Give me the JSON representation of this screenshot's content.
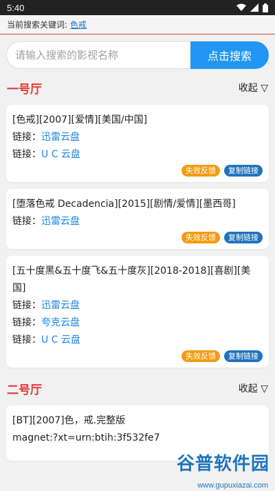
{
  "status_bar": {
    "time": "5:40"
  },
  "keyword_bar": {
    "label": "当前搜索关键词:",
    "keyword": "色戒"
  },
  "search": {
    "placeholder": "请输入搜索的影视名称",
    "button_label": "点击搜索"
  },
  "sections": [
    {
      "title": "一号厅",
      "collapse_label": "收起 ▽",
      "cards": [
        {
          "title": "[色戒][2007][爱情][美国/中国]",
          "links": [
            {
              "label": "链接：",
              "text": "迅雷云盘"
            },
            {
              "label": "链接：",
              "text": "U C 云盘"
            }
          ],
          "feedback_label": "失效反馈",
          "copy_label": "复制链接"
        },
        {
          "title": "[堕落色戒 Decadencia][2015][剧情/爱情][墨西哥]",
          "links": [
            {
              "label": "链接：",
              "text": "迅雷云盘"
            }
          ],
          "feedback_label": "失效反馈",
          "copy_label": "复制链接"
        },
        {
          "title": "[五十度黑&五十度飞&五十度灰][2018-2018][喜剧][美国]",
          "links": [
            {
              "label": "链接：",
              "text": "迅雷云盘"
            },
            {
              "label": "链接：",
              "text": "夸克云盘"
            },
            {
              "label": "链接：",
              "text": "U C 云盘"
            }
          ],
          "feedback_label": "失效反馈",
          "copy_label": "复制链接"
        }
      ]
    },
    {
      "title": "二号厅",
      "collapse_label": "收起 ▽",
      "cards": [
        {
          "title": "[BT][2007]色，戒.完整版",
          "line2": "magnet:?xt=urn:btih:3f532fe7"
        }
      ]
    }
  ],
  "watermark": {
    "main": "谷普软件园",
    "url": "www.gupuxiazai.com"
  },
  "colors": {
    "accent_red": "#e53935",
    "primary_blue": "#2196f3",
    "link_blue": "#1e88e5",
    "badge_orange": "#f39c12",
    "badge_blue": "#1e73be"
  }
}
